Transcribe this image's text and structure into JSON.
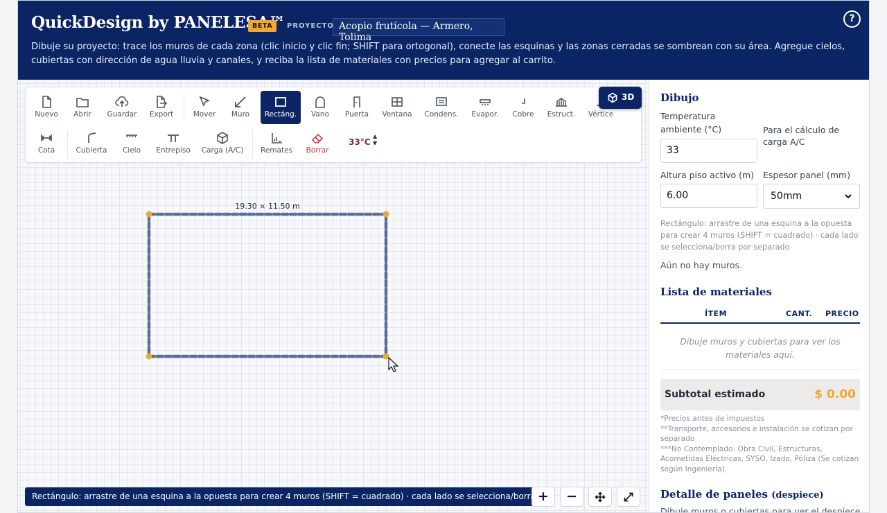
{
  "header": {
    "title": "QuickDesign by PANELESA™",
    "beta": "BETA",
    "project_label": "PROYECTO",
    "project_name": "Acopio frutícola — Armero, Tolima",
    "help": "?",
    "description": "Dibuje su proyecto: trace los muros de cada zona (clic inicio y clic fin; SHIFT para ortogonal), conecte las esquinas y las zonas cerradas se sombrean con su área. Agregue cielos, cubiertas con dirección de agua lluvia y canales, y reciba la lista de materiales con precios para agregar al carrito."
  },
  "toolbar": {
    "row1": [
      {
        "id": "nuevo",
        "label": "Nuevo",
        "icon": "file-icon"
      },
      {
        "id": "abrir",
        "label": "Abrir",
        "icon": "folder-icon"
      },
      {
        "id": "guardar",
        "label": "Guardar",
        "icon": "cloud-upload-icon"
      },
      {
        "id": "export",
        "label": "Export",
        "icon": "file-export-icon"
      },
      {
        "id": "mover",
        "label": "Mover",
        "icon": "cursor-icon"
      },
      {
        "id": "muro",
        "label": "Muro",
        "icon": "wall-line-icon"
      },
      {
        "id": "rectang",
        "label": "Rectáng.",
        "icon": "rectangle-icon"
      },
      {
        "id": "vano",
        "label": "Vano",
        "icon": "arch-icon"
      },
      {
        "id": "puerta",
        "label": "Puerta",
        "icon": "door-icon"
      },
      {
        "id": "ventana",
        "label": "Ventana",
        "icon": "window-icon"
      },
      {
        "id": "condens",
        "label": "Condens.",
        "icon": "condenser-icon"
      },
      {
        "id": "evapor",
        "label": "Evapor.",
        "icon": "evaporator-icon"
      },
      {
        "id": "cobre",
        "label": "Cobre",
        "icon": "copper-pipe-icon"
      },
      {
        "id": "estruct",
        "label": "Estruct.",
        "icon": "structure-icon"
      },
      {
        "id": "vertice",
        "label": "Vértice",
        "icon": "vertex-icon"
      }
    ],
    "row2": [
      {
        "id": "cota",
        "label": "Cota",
        "icon": "dimension-icon"
      },
      {
        "id": "cubierta",
        "label": "Cubierta",
        "icon": "roof-icon"
      },
      {
        "id": "cielo",
        "label": "Cielo",
        "icon": "ceiling-icon"
      },
      {
        "id": "entrepiso",
        "label": "Entrepiso",
        "icon": "mezzanine-icon"
      },
      {
        "id": "carga",
        "label": "Carga (A/C)",
        "icon": "cube-icon"
      },
      {
        "id": "remates",
        "label": "Remates",
        "icon": "trim-icon"
      },
      {
        "id": "borrar",
        "label": "Borrar",
        "icon": "eraser-icon"
      }
    ],
    "active": "rectang",
    "temperature": "33°C",
    "btn_3d": "3D"
  },
  "canvas": {
    "dimension_label": "19.30 × 11.50 m",
    "status": "Rectángulo: arrastre de una esquina a la opuesta para crear 4 muros (SHIFT = cuadrado) · cada lado se selecciona/borra por separado",
    "zoom_in": "+",
    "zoom_out": "−",
    "colors": {
      "wall": "#5d6e98",
      "node": "#f0a733",
      "accent": "#0b2464"
    }
  },
  "panel": {
    "section_drawing": "Dibujo",
    "temp_label": "Temperatura ambiente (°C)",
    "temp_value": "33",
    "temp_note": "Para el cálculo de carga A/C",
    "height_label": "Altura piso activo (m)",
    "height_value": "6.00",
    "thickness_label": "Espesor panel (mm)",
    "thickness_value": "50mm",
    "hint": "Rectángulo: arrastre de una esquina a la opuesta para crear 4 muros (SHIFT = cuadrado) · cada lado se selecciona/borra por separado",
    "no_walls": "Aún no hay muros.",
    "materials_title": "Lista de materiales",
    "col_item": "ÍTEM",
    "col_qty": "CANT.",
    "col_price": "PRECIO",
    "empty_materials": "Dibuje muros y cubiertas para ver los materiales aquí.",
    "subtotal_label": "Subtotal estimado",
    "subtotal_value": "$ 0.00",
    "note1": "*Precios antes de impuestos",
    "note2": "**Transporte, accesorios e instalación se cotizan por separado",
    "note3": "***No Contemplado: Obra Civil, Estructuras, Acometidas Eléctricas, SYSO, Izado, Póliza (Se cotizan según Ingeniería).",
    "panels_title": "Detalle de paneles",
    "panels_sub": "(despiece)",
    "panels_empty": "Dibuje muros o cubiertas para ver el despiece"
  }
}
